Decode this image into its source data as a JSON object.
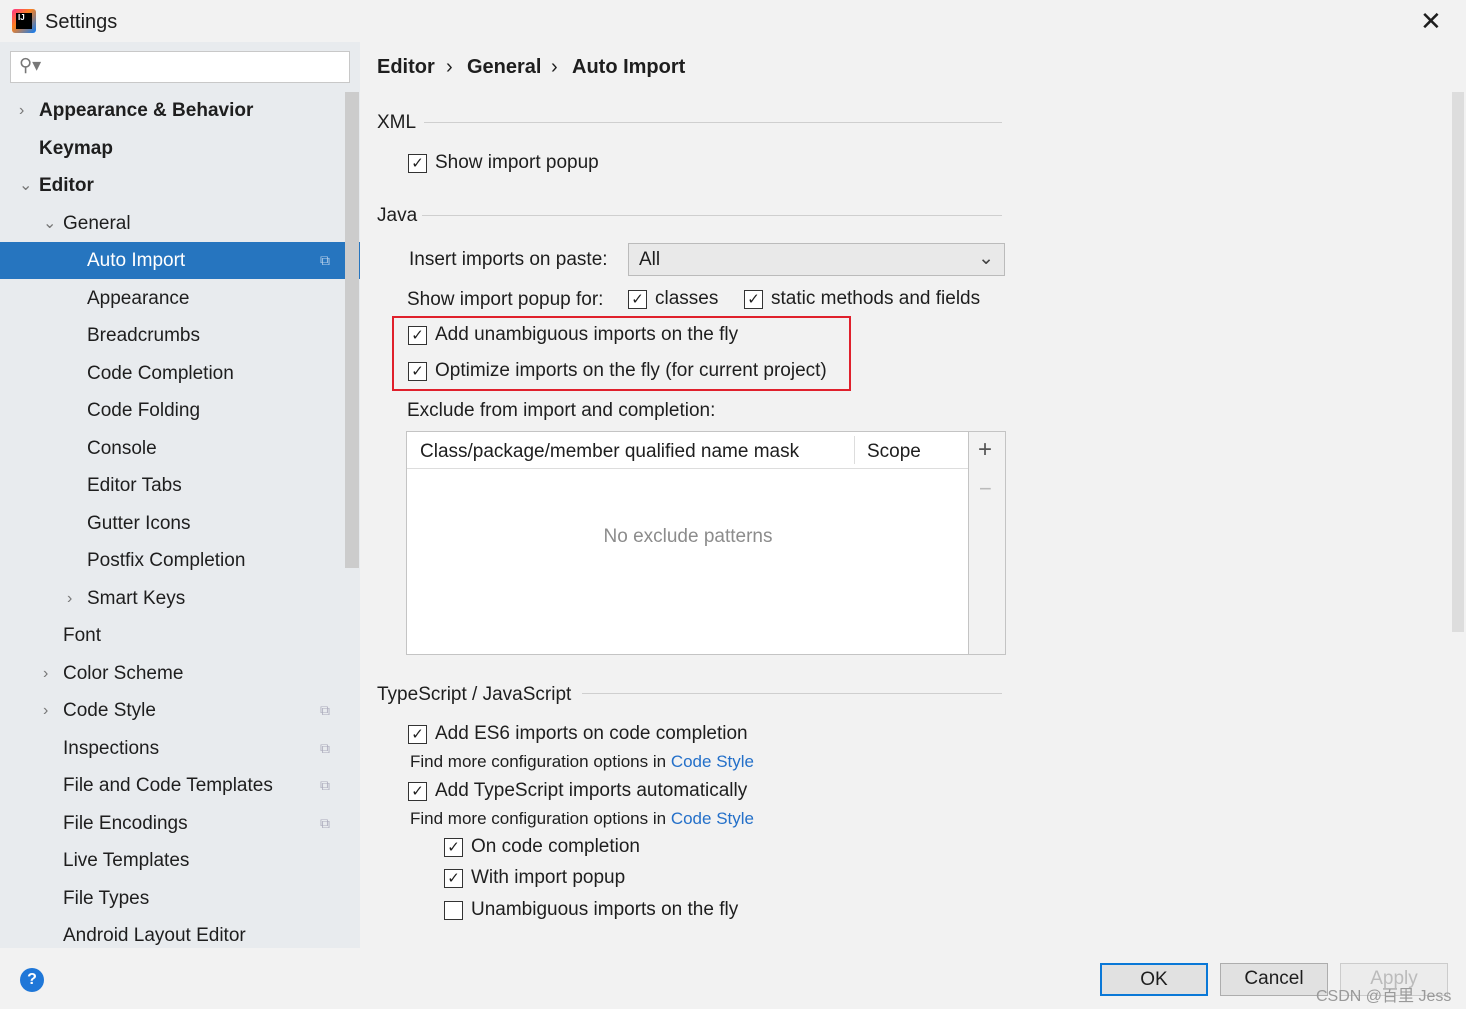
{
  "window": {
    "title": "Settings",
    "logo_text": "IJ",
    "close": "✕"
  },
  "search": {
    "icon": "search-icon",
    "value": ""
  },
  "tree": [
    {
      "label": "Appearance & Behavior",
      "level": 0,
      "arrow": "›",
      "bold": true
    },
    {
      "label": "Keymap",
      "level": 0,
      "arrow": "",
      "bold": true
    },
    {
      "label": "Editor",
      "level": 0,
      "arrow": "⌄",
      "bold": true
    },
    {
      "label": "General",
      "level": 1,
      "arrow": "⌄"
    },
    {
      "label": "Auto Import",
      "level": 2,
      "arrow": "",
      "selected": true,
      "copy": true
    },
    {
      "label": "Appearance",
      "level": 2,
      "arrow": ""
    },
    {
      "label": "Breadcrumbs",
      "level": 2,
      "arrow": ""
    },
    {
      "label": "Code Completion",
      "level": 2,
      "arrow": ""
    },
    {
      "label": "Code Folding",
      "level": 2,
      "arrow": ""
    },
    {
      "label": "Console",
      "level": 2,
      "arrow": ""
    },
    {
      "label": "Editor Tabs",
      "level": 2,
      "arrow": ""
    },
    {
      "label": "Gutter Icons",
      "level": 2,
      "arrow": ""
    },
    {
      "label": "Postfix Completion",
      "level": 2,
      "arrow": ""
    },
    {
      "label": "Smart Keys",
      "level": 2,
      "arrow": "›"
    },
    {
      "label": "Font",
      "level": 1,
      "arrow": ""
    },
    {
      "label": "Color Scheme",
      "level": 1,
      "arrow": "›"
    },
    {
      "label": "Code Style",
      "level": 1,
      "arrow": "›",
      "copy": true
    },
    {
      "label": "Inspections",
      "level": 1,
      "arrow": "",
      "copy": true
    },
    {
      "label": "File and Code Templates",
      "level": 1,
      "arrow": "",
      "copy": true
    },
    {
      "label": "File Encodings",
      "level": 1,
      "arrow": "",
      "copy": true
    },
    {
      "label": "Live Templates",
      "level": 1,
      "arrow": ""
    },
    {
      "label": "File Types",
      "level": 1,
      "arrow": ""
    },
    {
      "label": "Android Layout Editor",
      "level": 1,
      "arrow": ""
    }
  ],
  "breadcrumb": [
    "Editor",
    "General",
    "Auto Import"
  ],
  "breadcrumb_sep": "›",
  "xml": {
    "title": "XML",
    "show_popup": {
      "label": "Show import popup",
      "checked": true
    }
  },
  "java": {
    "title": "Java",
    "insert_label": "Insert imports on paste:",
    "insert_value": "All",
    "popup_for_label": "Show import popup for:",
    "classes": {
      "label": "classes",
      "checked": true
    },
    "static": {
      "label": "static methods and fields",
      "checked": true
    },
    "unambiguous": {
      "label": "Add unambiguous imports on the fly",
      "checked": true
    },
    "optimize": {
      "label": "Optimize imports on the fly (for current project)",
      "checked": true
    },
    "exclude_label": "Exclude from import and completion:",
    "table": {
      "columns": [
        "Class/package/member qualified name mask",
        "Scope"
      ],
      "empty": "No exclude patterns",
      "add": "+",
      "remove": "−"
    }
  },
  "ts": {
    "title": "TypeScript / JavaScript",
    "es6": {
      "label": "Add ES6 imports on code completion",
      "checked": true
    },
    "hint": "Find more configuration options in",
    "link": "Code Style",
    "tsauto": {
      "label": "Add TypeScript imports automatically",
      "checked": true
    },
    "on_completion": {
      "label": "On code completion",
      "checked": true
    },
    "with_popup": {
      "label": "With import popup",
      "checked": true
    },
    "unamb": {
      "label": "Unambiguous imports on the fly",
      "checked": false
    }
  },
  "buttons": {
    "ok": "OK",
    "cancel": "Cancel",
    "apply": "Apply",
    "help": "?"
  },
  "watermark": "CSDN @百里 Jess",
  "colors": {
    "selection": "#2675bf",
    "highlight": "#e0202c",
    "link": "#2470c9"
  }
}
